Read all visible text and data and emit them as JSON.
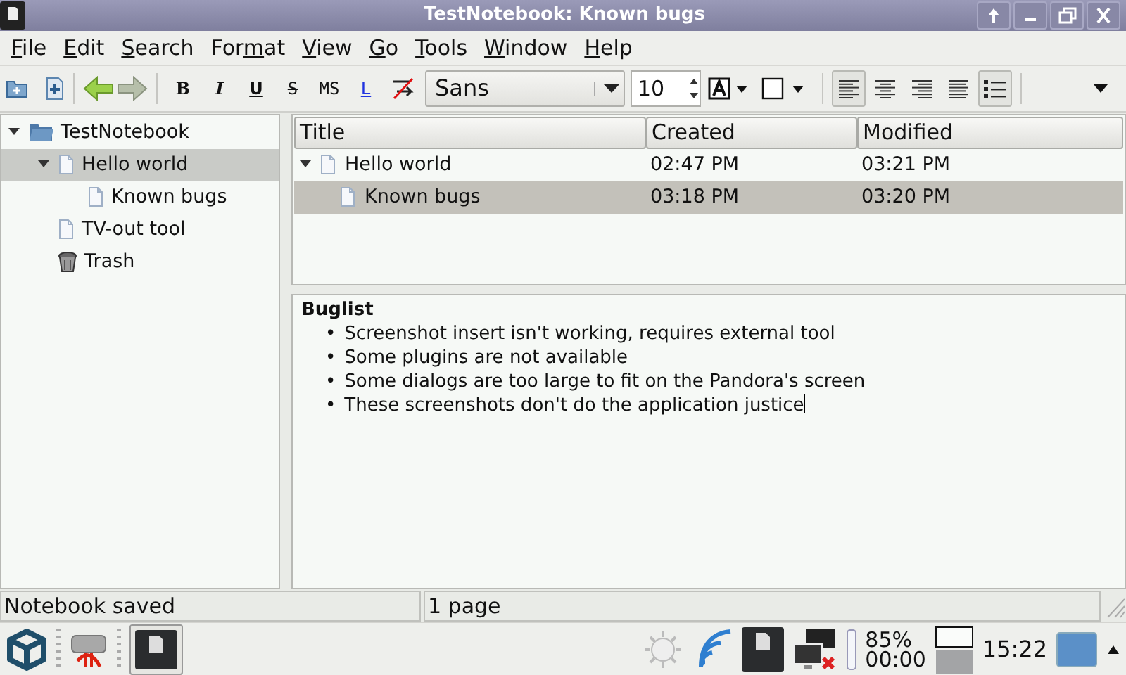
{
  "window": {
    "title": "TestNotebook: Known bugs"
  },
  "menu": [
    {
      "key": "F",
      "after": "ile"
    },
    {
      "key": "E",
      "after": "dit"
    },
    {
      "key": "S",
      "after": "earch"
    },
    {
      "before": "For",
      "key": "m",
      "after": "at"
    },
    {
      "key": "V",
      "after": "iew"
    },
    {
      "key": "G",
      "after": "o"
    },
    {
      "key": "T",
      "after": "ools"
    },
    {
      "key": "W",
      "after": "indow"
    },
    {
      "key": "H",
      "after": "elp"
    }
  ],
  "toolbar": {
    "format_buttons": [
      {
        "label": "B",
        "kind": "bold"
      },
      {
        "label": "I",
        "kind": "italic"
      },
      {
        "label": "U",
        "kind": "underline"
      },
      {
        "label": "S",
        "kind": "strike"
      },
      {
        "label": "MS",
        "kind": "mono"
      },
      {
        "label": "L",
        "kind": "link"
      }
    ],
    "font": "Sans",
    "size": "10",
    "align_buttons": [
      {
        "selected": true
      },
      {
        "selected": false
      },
      {
        "selected": false
      },
      {
        "selected": false
      }
    ],
    "bullets": {
      "selected": true
    }
  },
  "tree": [
    {
      "label": "TestNotebook",
      "kind": "notebook",
      "expanded": true,
      "selected": false,
      "children": [
        {
          "label": "Hello world",
          "kind": "page",
          "expanded": true,
          "selected": true,
          "children": [
            {
              "label": "Known bugs",
              "kind": "page",
              "selected": false
            }
          ]
        },
        {
          "label": "TV-out tool",
          "kind": "page",
          "selected": false
        },
        {
          "label": "Trash",
          "kind": "trash",
          "selected": false
        }
      ]
    }
  ],
  "table": {
    "columns": [
      "Title",
      "Created",
      "Modified"
    ],
    "rows": [
      {
        "title": "Hello world",
        "created": "02:47 PM",
        "modified": "03:21 PM",
        "expanded": true,
        "selected": false,
        "children": [
          {
            "title": "Known bugs",
            "created": "03:18 PM",
            "modified": "03:20 PM",
            "selected": true
          }
        ]
      }
    ]
  },
  "editor": {
    "heading": "Buglist",
    "items": [
      {
        "bullet": "•",
        "text": "Screenshot insert isn't working, requires external tool"
      },
      {
        "bullet": "•",
        "text": "Some plugins are not available"
      },
      {
        "bullet": "•",
        "text": "Some dialogs are too large to fit on the Pandora's screen"
      },
      {
        "bullet": "•",
        "text": "These screenshots don't do the application justice"
      }
    ]
  },
  "status_bar": [
    "Notebook saved",
    "1 page"
  ],
  "taskbar": {
    "battery_percent": "85%",
    "battery_time": "00:00",
    "clock": "15:22"
  }
}
